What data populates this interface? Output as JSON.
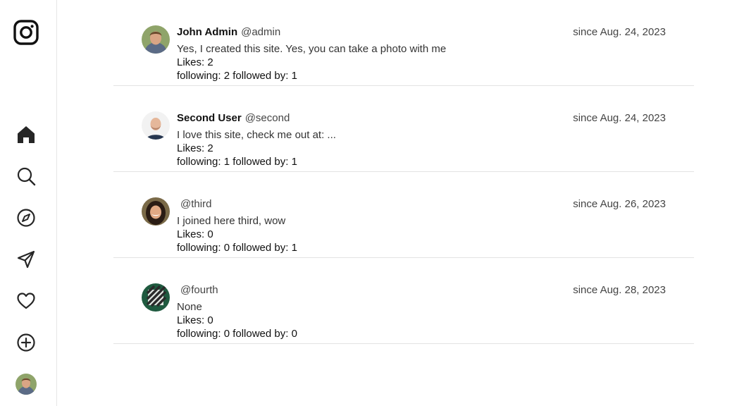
{
  "sidebar": {
    "items": [
      {
        "icon": "home-icon"
      },
      {
        "icon": "search-icon"
      },
      {
        "icon": "compass-icon"
      },
      {
        "icon": "send-icon"
      },
      {
        "icon": "heart-icon"
      },
      {
        "icon": "plus-circle-icon"
      }
    ],
    "logo_icon": "instagram-logo-icon",
    "profile_avatar": "avatar"
  },
  "users": [
    {
      "display_name": "John Admin",
      "username": "@admin",
      "bio": "Yes, I created this site. Yes, you can take a photo with me",
      "likes": "Likes: 2",
      "follow": "following: 2 followed by: 1",
      "since": "since Aug. 24, 2023"
    },
    {
      "display_name": "Second User",
      "username": "@second",
      "bio": "I love this site, check me out at: ...",
      "likes": "Likes: 2",
      "follow": "following: 1 followed by: 1",
      "since": "since Aug. 24, 2023"
    },
    {
      "display_name": "",
      "username": "@third",
      "bio": "I joined here third, wow",
      "likes": "Likes: 0",
      "follow": "following: 0 followed by: 1",
      "since": "since Aug. 26, 2023"
    },
    {
      "display_name": "",
      "username": "@fourth",
      "bio": "None",
      "likes": "Likes: 0",
      "follow": "following: 0 followed by: 0",
      "since": "since Aug. 28, 2023"
    }
  ],
  "colors": {
    "icon": "#262626",
    "divider": "#e3e3e3",
    "muted_text": "#444444"
  }
}
